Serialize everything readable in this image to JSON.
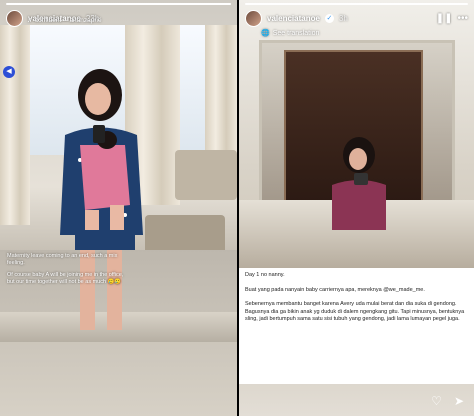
{
  "story_left": {
    "username": "valenciatanoe",
    "time": "23h",
    "music": {
      "icon": "music-icon",
      "label": "confident",
      "artist": "ananzaprié"
    },
    "caption": [
      "Maternity leave coming to an end, such a mix feeling.",
      "Of course baby A will be joining me in the office, but our time together will not be as much 🥲🥲"
    ],
    "colors": {
      "mute_bg": "#2d4fd6"
    }
  },
  "story_right": {
    "username": "valenciatanoe",
    "time": "3h",
    "translation": "See translation",
    "body": [
      "Day 1 no nanny.",
      "Buat yang pada nanyain baby carriernya apa, mereknya @we_made_me.",
      "Sebenernya membantu banget karena Avery uda mulai berat dan dia suka di gendong. Bagusnya dia ga bikin anak yg duduk di dalem ngengkang gitu. Tapi minusnya, bentuknya sling, jadi bertumpuh sama satu sisi tubuh yang gendong, jadi lama lumayan pegel juga."
    ]
  }
}
